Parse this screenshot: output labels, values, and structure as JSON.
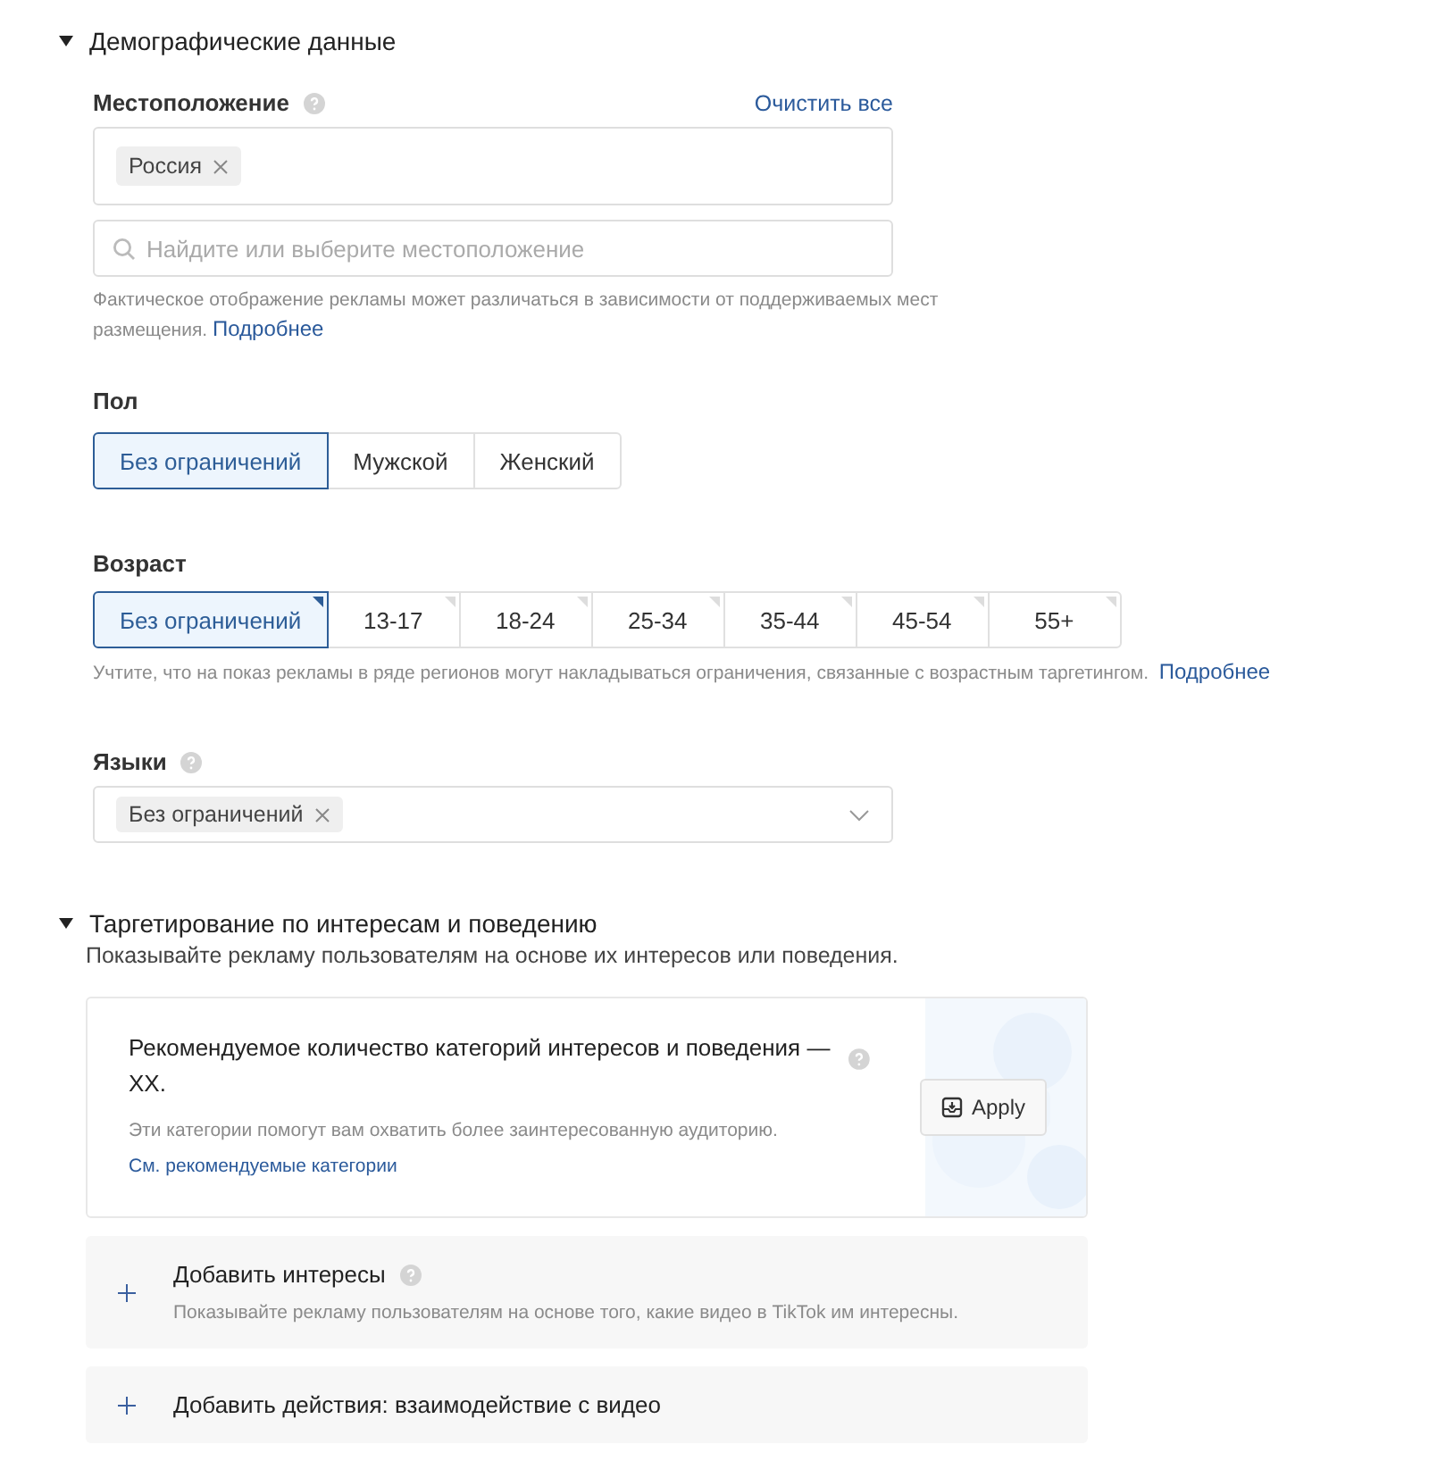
{
  "demographics": {
    "title": "Демографические данные",
    "expanded": true,
    "location": {
      "label": "Местоположение",
      "clear_link": "Очистить все",
      "tags": [
        "Россия"
      ],
      "search_placeholder": "Найдите или выберите местоположение",
      "note": "Фактическое отображение рекламы может различаться в зависимости от поддерживаемых мест размещения.",
      "note_link": "Подробнее"
    },
    "gender": {
      "label": "Пол",
      "options": [
        {
          "label": "Без ограничений",
          "selected": true
        },
        {
          "label": "Мужской",
          "selected": false
        },
        {
          "label": "Женский",
          "selected": false
        }
      ]
    },
    "age": {
      "label": "Возраст",
      "options": [
        {
          "label": "Без ограничений",
          "selected": true
        },
        {
          "label": "13-17",
          "selected": false
        },
        {
          "label": "18-24",
          "selected": false
        },
        {
          "label": "25-34",
          "selected": false
        },
        {
          "label": "35-44",
          "selected": false
        },
        {
          "label": "45-54",
          "selected": false
        },
        {
          "label": "55+",
          "selected": false
        }
      ],
      "note": "Учтите, что на показ рекламы в ряде регионов могут накладываться ограничения, связанные с возрастным таргетингом.",
      "note_link": "Подробнее"
    },
    "languages": {
      "label": "Языки",
      "tags": [
        "Без ограничений"
      ]
    }
  },
  "interests": {
    "title": "Таргетирование по интересам и поведению",
    "expanded": true,
    "subtitle": "Показывайте рекламу пользователям на основе их интересов или поведения.",
    "recommendation": {
      "title": "Рекомендуемое количество категорий интересов и поведения — XX.",
      "text": "Эти категории помогут вам охватить более заинтересованную аудиторию.",
      "link": "См. рекомендуемые категории",
      "button": "Apply"
    },
    "items": [
      {
        "title": "Добавить интересы",
        "help": true,
        "description": "Показывайте рекламу пользователям на основе того, какие видео в TikTok им интересны."
      },
      {
        "title": "Добавить действия: взаимодействие с видео",
        "help": false
      }
    ]
  }
}
